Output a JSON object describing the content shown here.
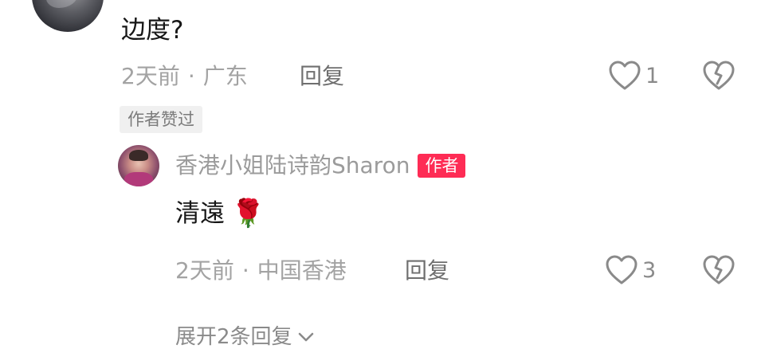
{
  "comment": {
    "text": "边度?",
    "time": "2天前",
    "separator": "·",
    "location": "广东",
    "reply_label": "回复",
    "like_count": "1",
    "author_liked_tag": "作者赞过"
  },
  "reply": {
    "username": "香港小姐陆诗韵Sharon",
    "author_badge": "作者",
    "text": "清遠",
    "emoji": "🌹",
    "time": "2天前",
    "separator": "·",
    "location": "中国香港",
    "reply_label": "回复",
    "like_count": "3"
  },
  "expand": {
    "label": "展开2条回复"
  },
  "icons": {
    "like": "heart-outline-icon",
    "dislike": "broken-heart-icon",
    "expand": "chevron-down-icon"
  },
  "colors": {
    "author_badge_bg": "#fe2c55",
    "meta_text": "#a3a3a3",
    "primary_text": "#161616"
  }
}
